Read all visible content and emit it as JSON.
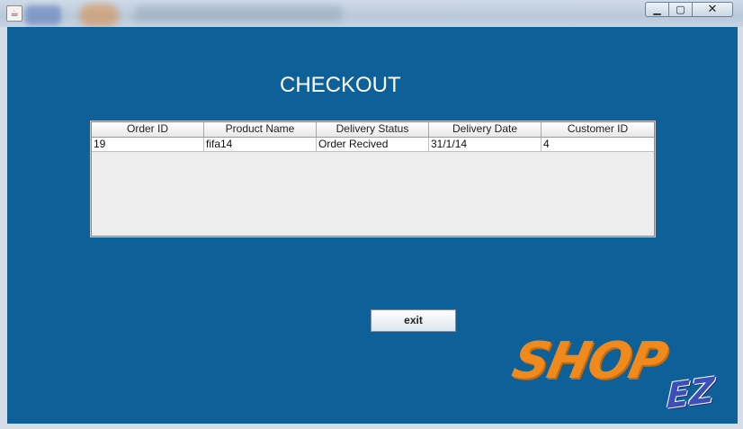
{
  "window": {
    "title": "",
    "app_icon": "java-icon",
    "minimize_label": "▭",
    "maximize_label": "▣",
    "close_label": "✕"
  },
  "main": {
    "heading": "CHECKOUT",
    "exit_label": "exit"
  },
  "table": {
    "columns": [
      "Order ID",
      "Product Name",
      "Delivery Status",
      "Delivery Date",
      "Customer ID"
    ],
    "rows": [
      [
        "19",
        "fifa14",
        "Order Recived",
        "31/1/14",
        "4"
      ]
    ]
  },
  "logo": {
    "word": "SHOP",
    "suffix": "EZ"
  },
  "colors": {
    "content_bg": "#0e6198",
    "logo_orange": "#f08a1c",
    "logo_blue": "#3b4fb8"
  }
}
